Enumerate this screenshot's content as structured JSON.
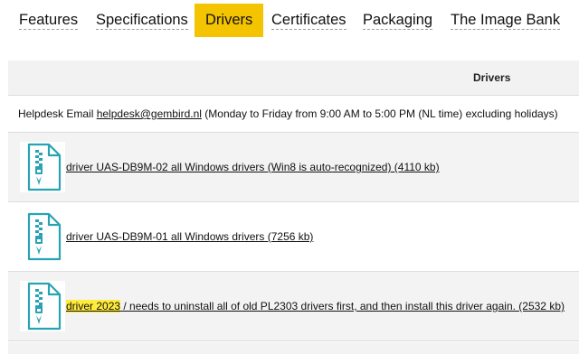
{
  "tabs": [
    {
      "label": "Features",
      "active": false
    },
    {
      "label": "Specifications",
      "active": false
    },
    {
      "label": "Drivers",
      "active": true
    },
    {
      "label": "Certificates",
      "active": false
    },
    {
      "label": "Packaging",
      "active": false
    },
    {
      "label": "The Image Bank",
      "active": false
    }
  ],
  "table": {
    "header": "Drivers",
    "helpdesk": {
      "prefix": "Helpdesk Email ",
      "email": "helpdesk@gembird.nl",
      "suffix": " (Monday to Friday from 9:00 AM to 5:00 PM (NL time) excluding holidays)"
    },
    "rows": [
      {
        "icon": "zip-file-icon",
        "link": "driver UAS-DB9M-02 all Windows drivers (Win8 is auto-recognized) (4110 kb)"
      },
      {
        "icon": "zip-file-icon",
        "link": "driver UAS-DB9M-01 all Windows drivers (7256 kb)"
      },
      {
        "icon": "zip-file-icon",
        "highlight": "driver 2023",
        "tail": " / needs to uninstall all of old PL2303 drivers first, and then install this driver again. (2532 kb)"
      }
    ]
  },
  "colors": {
    "accent": "#f5c400",
    "icon": "#29a3b3",
    "highlight": "#ffeb3b"
  }
}
